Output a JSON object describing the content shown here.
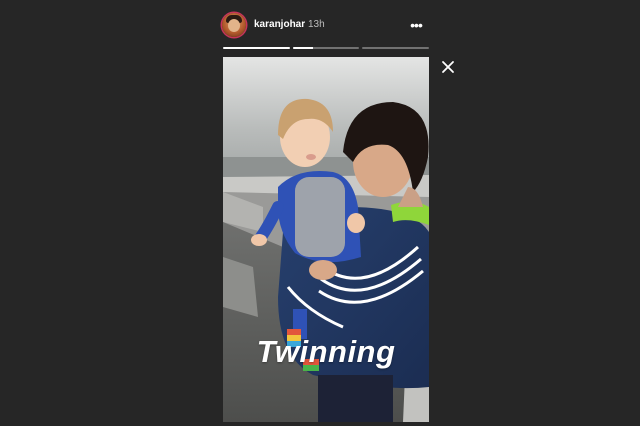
{
  "header": {
    "username": "karanjohar",
    "time": "13h",
    "more_label": "•••"
  },
  "progress": {
    "segments": [
      1.0,
      0.3,
      0.0
    ],
    "active_index": 1
  },
  "story": {
    "caption": "Twinning"
  },
  "icons": {
    "close": "close-icon",
    "more": "more-horizontal-icon",
    "avatar": "profile-avatar"
  },
  "colors": {
    "background": "#262626",
    "avatar_ring": "#c8345a",
    "text": "#ffffff"
  }
}
